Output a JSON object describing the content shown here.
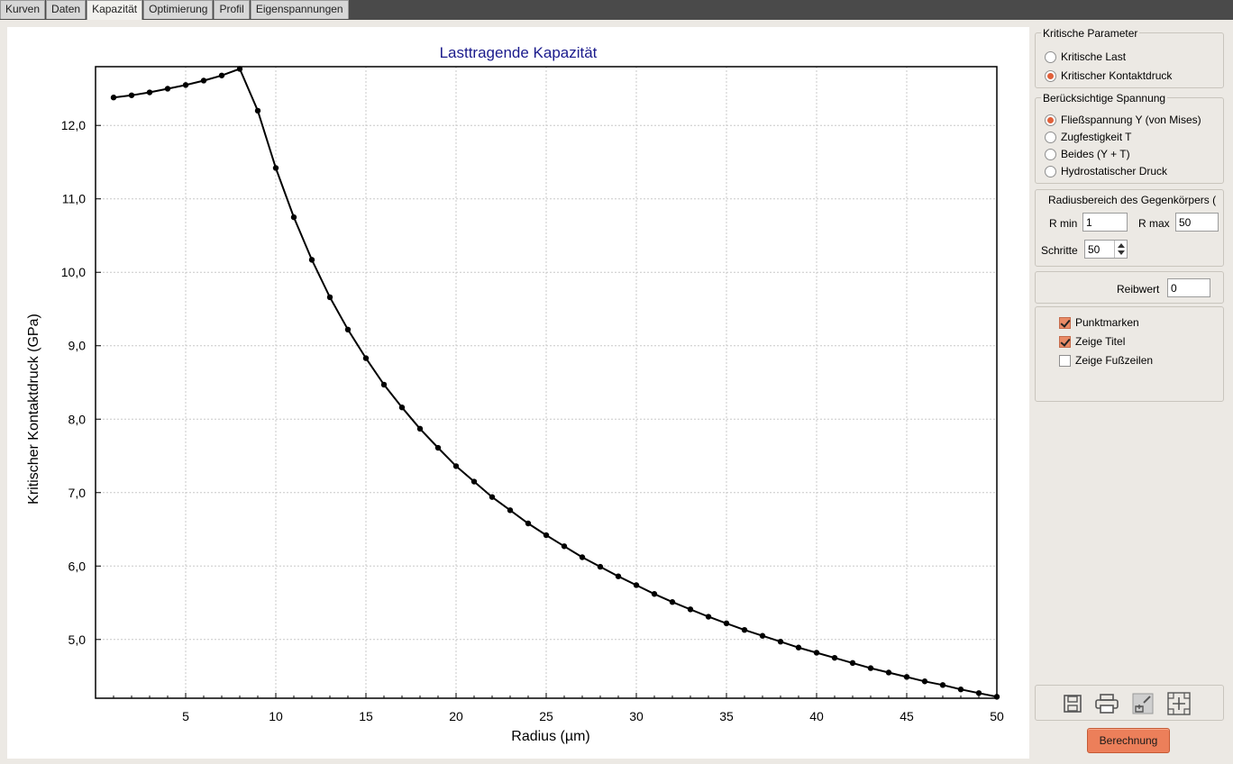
{
  "tabs": [
    {
      "label": "Kurven",
      "active": false
    },
    {
      "label": "Daten",
      "active": false
    },
    {
      "label": "Kapazität",
      "active": true
    },
    {
      "label": "Optimierung",
      "active": false
    },
    {
      "label": "Profil",
      "active": false
    },
    {
      "label": "Eigenspannungen",
      "active": false
    }
  ],
  "panel": {
    "critical_params": {
      "title": "Kritische Parameter",
      "options": [
        {
          "label": "Kritische Last",
          "selected": false
        },
        {
          "label": "Kritischer Kontaktdruck",
          "selected": true
        }
      ]
    },
    "stress": {
      "title": "Berücksichtige Spannung",
      "options": [
        {
          "label": "Fließspannung Y (von Mises)",
          "selected": true
        },
        {
          "label": "Zugfestigkeit T",
          "selected": false
        },
        {
          "label": "Beides (Y + T)",
          "selected": false
        },
        {
          "label": "Hydrostatischer Druck",
          "selected": false
        }
      ]
    },
    "radius_range": {
      "title": "Radiusbereich des Gegenkörpers (",
      "rmin_label": "R min",
      "rmin_value": "1",
      "rmax_label": "R max",
      "rmax_value": "50",
      "steps_label": "Schritte",
      "steps_value": "50"
    },
    "friction": {
      "label": "Reibwert",
      "value": "0"
    },
    "checks": [
      {
        "label": "Punktmarken",
        "checked": true
      },
      {
        "label": "Zeige Titel",
        "checked": true
      },
      {
        "label": "Zeige Fußzeilen",
        "checked": false
      }
    ],
    "icons": [
      "save-icon",
      "print-icon",
      "zoom-icon",
      "fit-icon"
    ],
    "calc_button": "Berechnung",
    "accent": "#ec7f5a"
  },
  "chart_data": {
    "type": "line",
    "title": "Lasttragende Kapazität",
    "xlabel": "Radius (µm)",
    "ylabel": "Kritischer Kontaktdruck (GPa)",
    "xlim": [
      0,
      50
    ],
    "ylim": [
      4.2,
      12.8
    ],
    "xticks": [
      5,
      10,
      15,
      20,
      25,
      30,
      35,
      40,
      45,
      50
    ],
    "yticks": [
      5.0,
      6.0,
      7.0,
      8.0,
      9.0,
      10.0,
      11.0,
      12.0
    ],
    "ytick_labels": [
      "5,0",
      "6,0",
      "7,0",
      "8,0",
      "9,0",
      "10,0",
      "11,0",
      "12,0"
    ],
    "grid": true,
    "line_color": "#000000",
    "title_color": "#1a1a8c",
    "x": [
      1,
      2,
      3,
      4,
      5,
      6,
      7,
      8,
      9,
      10,
      11,
      12,
      13,
      14,
      15,
      16,
      17,
      18,
      19,
      20,
      21,
      22,
      23,
      24,
      25,
      26,
      27,
      28,
      29,
      30,
      31,
      32,
      33,
      34,
      35,
      36,
      37,
      38,
      39,
      40,
      41,
      42,
      43,
      44,
      45,
      46,
      47,
      48,
      49,
      50
    ],
    "y": [
      12.38,
      12.41,
      12.45,
      12.5,
      12.55,
      12.61,
      12.68,
      12.77,
      12.2,
      11.42,
      10.75,
      10.17,
      9.66,
      9.22,
      8.83,
      8.47,
      8.16,
      7.87,
      7.61,
      7.36,
      7.15,
      6.94,
      6.76,
      6.58,
      6.42,
      6.27,
      6.12,
      5.99,
      5.86,
      5.74,
      5.62,
      5.51,
      5.41,
      5.31,
      5.22,
      5.13,
      5.05,
      4.97,
      4.89,
      4.82,
      4.75,
      4.68,
      4.61,
      4.55,
      4.49,
      4.43,
      4.38,
      4.32,
      4.27,
      4.22
    ]
  }
}
